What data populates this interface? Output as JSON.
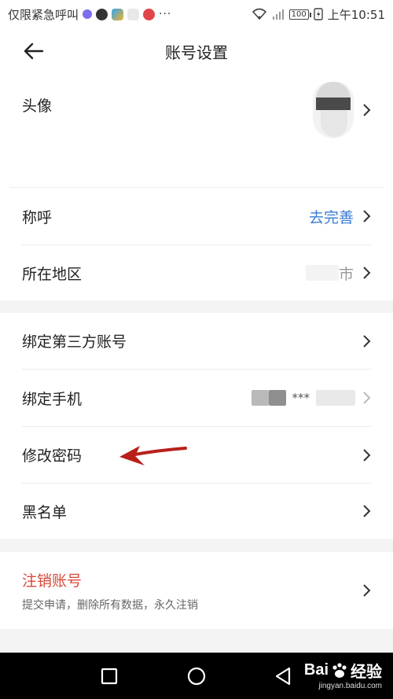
{
  "status_bar": {
    "carrier": "仅限紧急呼叫",
    "more": "···",
    "battery": "100",
    "time": "上午10:51"
  },
  "header": {
    "title": "账号设置"
  },
  "rows": {
    "avatar_label": "头像",
    "nickname_label": "称呼",
    "nickname_value": "去完善",
    "region_label": "所在地区",
    "region_value": "市",
    "third_party_label": "绑定第三方账号",
    "phone_label": "绑定手机",
    "phone_value": "***",
    "password_label": "修改密码",
    "blacklist_label": "黑名单",
    "delete_label": "注销账号",
    "delete_sub": "提交申请，删除所有数据，永久注销"
  },
  "colors": {
    "accent": "#3a7bd5",
    "danger": "#d7493a",
    "arrow": "#b8201a"
  },
  "watermark": {
    "brand_a": "Bai",
    "brand_b": "经验",
    "url": "jingyan.baidu.com"
  }
}
